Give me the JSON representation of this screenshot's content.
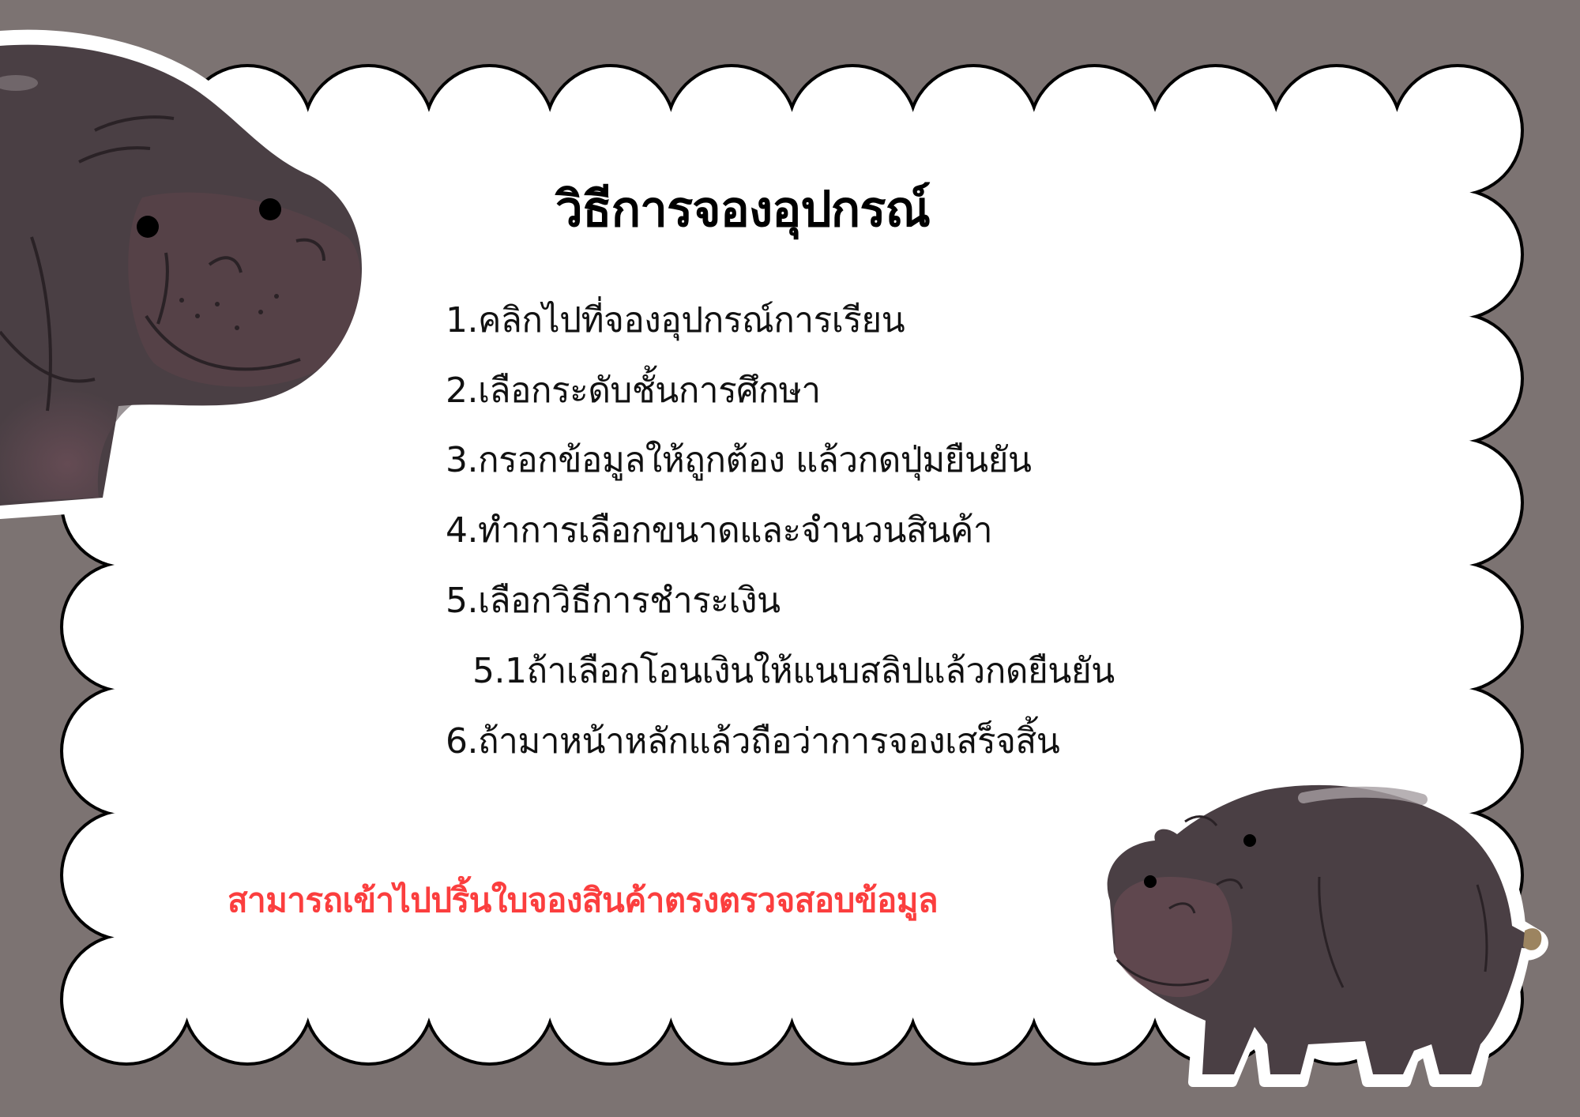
{
  "title": "วิธีการจองอุปกรณ์",
  "steps": [
    "1.คลิกไปที่จองอุปกรณ์การเรียน",
    "2.เลือกระดับชั้นการศึกษา",
    "3.กรอกข้อมูลให้ถูกต้อง แล้วกดปุ่มยืนยัน",
    "4.ทำการเลือกขนาดและจำนวนสินค้า",
    "5.เลือกวิธีการชำระเงิน",
    "5.1ถ้าเลือกโอนเงินให้แนบสลิปแล้วกดยืนยัน",
    "6.ถ้ามาหน้าหลักแล้วถือว่าการจองเสร็จสิ้น"
  ],
  "note": "สามารถเข้าไปปริ้นใบจองสินค้าตรงตรวจสอบข้อมูล",
  "colors": {
    "background": "#7c7372",
    "card": "#ffffff",
    "card_outline": "#000000",
    "note_text": "#fb3e3e",
    "hippo_body": "#4a3f44",
    "hippo_belly": "#6e4d55"
  },
  "icons": [
    "hippo-illustration-top-left",
    "hippo-illustration-bottom-right"
  ]
}
